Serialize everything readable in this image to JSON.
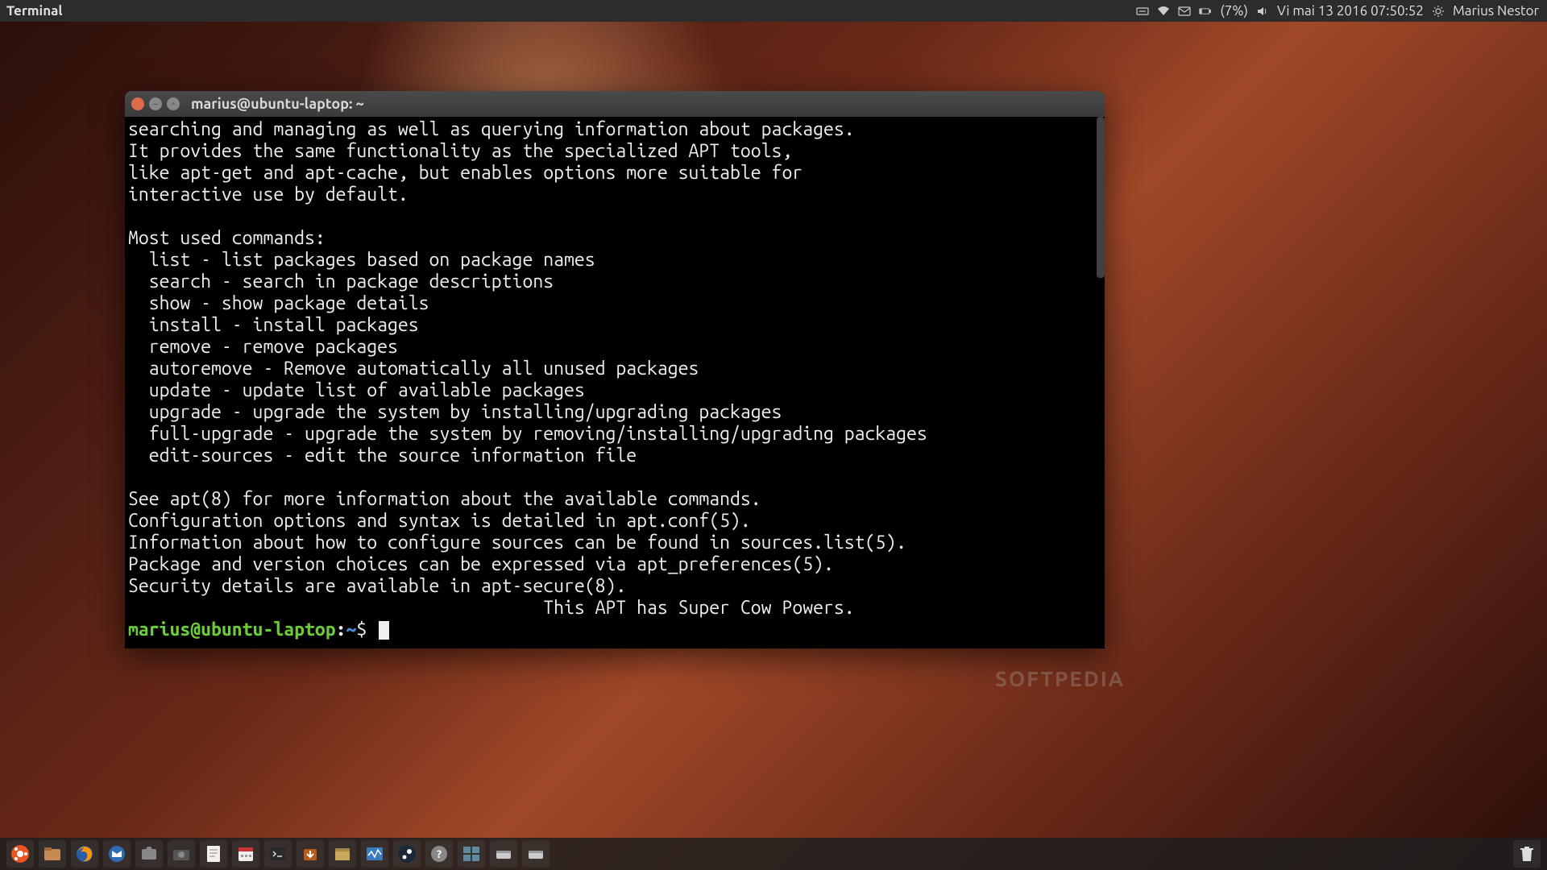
{
  "top_panel": {
    "app_name": "Terminal",
    "battery": "(7%)",
    "datetime": "Vi mai 13 2016 07:50:52",
    "username": "Marius Nestor"
  },
  "terminal": {
    "title": "marius@ubuntu-laptop: ~",
    "output_lines": [
      "searching and managing as well as querying information about packages.",
      "It provides the same functionality as the specialized APT tools,",
      "like apt-get and apt-cache, but enables options more suitable for",
      "interactive use by default.",
      "",
      "Most used commands:",
      "  list - list packages based on package names",
      "  search - search in package descriptions",
      "  show - show package details",
      "  install - install packages",
      "  remove - remove packages",
      "  autoremove - Remove automatically all unused packages",
      "  update - update list of available packages",
      "  upgrade - upgrade the system by installing/upgrading packages",
      "  full-upgrade - upgrade the system by removing/installing/upgrading packages",
      "  edit-sources - edit the source information file",
      "",
      "See apt(8) for more information about the available commands.",
      "Configuration options and syntax is detailed in apt.conf(5).",
      "Information about how to configure sources can be found in sources.list(5).",
      "Package and version choices can be expressed via apt_preferences(5).",
      "Security details are available in apt-secure(8).",
      "                                        This APT has Super Cow Powers."
    ],
    "prompt": {
      "user_host": "marius@ubuntu-laptop",
      "path": "~",
      "symbol": "$"
    }
  },
  "watermark": "SOFTPEDIA",
  "launcher_icons": [
    "start-menu-icon",
    "files-icon",
    "firefox-icon",
    "thunderbird-icon",
    "screenshot-icon",
    "camera-icon",
    "text-editor-icon",
    "calendar-icon",
    "terminal-icon",
    "software-updater-icon",
    "archive-icon",
    "system-monitor-icon",
    "steam-icon",
    "help-icon",
    "workspace-icon",
    "removable-disk-icon",
    "removable-disk-icon"
  ],
  "launcher_right": "trash-icon"
}
